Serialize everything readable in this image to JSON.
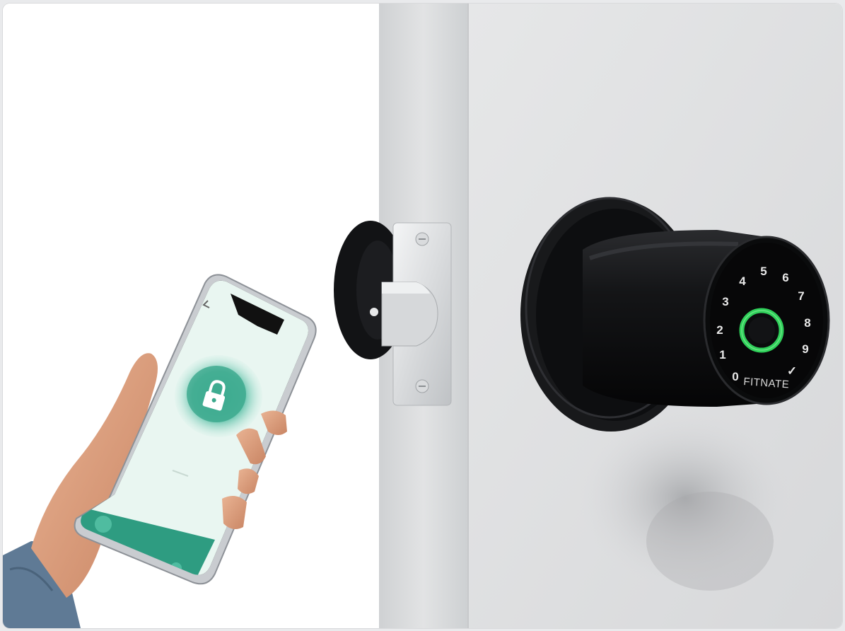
{
  "image": {
    "subject": "smart-door-knob-with-phone-app",
    "colors": {
      "background": "#ffffff",
      "door": "#dfe0e1",
      "lock_black": "#111214",
      "fingerprint_ring": "#2fd05a",
      "app_accent": "#3bb094",
      "phone_frame": "#c9ccd0"
    }
  },
  "lock": {
    "brand": "FITNATE",
    "keypad": [
      "1",
      "2",
      "3",
      "4",
      "5",
      "6",
      "7",
      "8",
      "9",
      "0",
      "✓"
    ],
    "fingerprint_icon": "fingerprint-sensor-icon"
  },
  "phone": {
    "title": "",
    "status": "",
    "row_text": "",
    "icons": [
      "back-arrow-icon",
      "padlock-icon",
      "key-icon",
      "unlock-icon"
    ]
  }
}
